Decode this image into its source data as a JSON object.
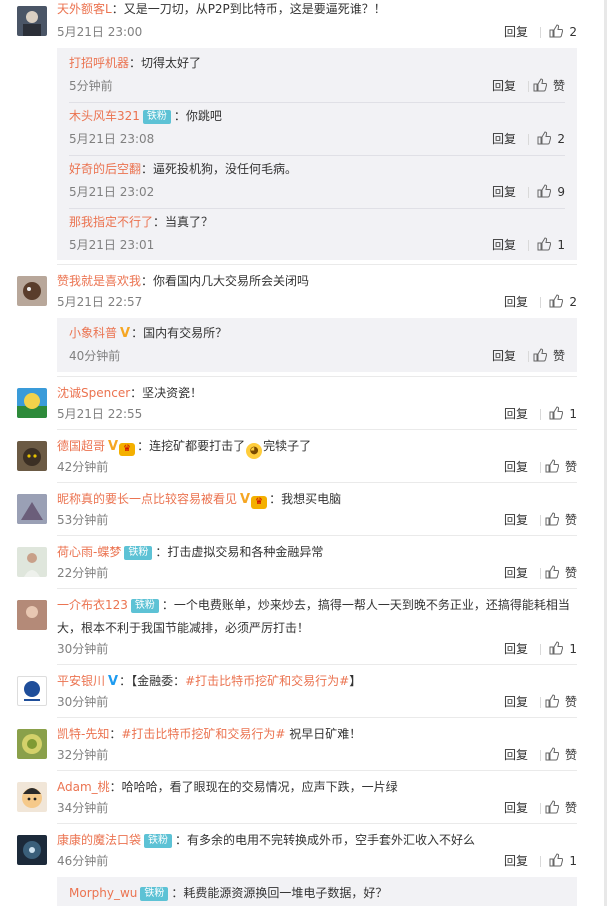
{
  "like_label": "赞",
  "reply_label": "回复",
  "badge_label": "铁粉",
  "comments": [
    {
      "name": "天外额客L",
      "text": "：又是一刀切，从P2P到比特币，这是要逼死谁？！",
      "time": "5月21日 23:00",
      "likes": "2",
      "replies": [
        {
          "name": "打招呼机器",
          "text": "：切得太好了",
          "time": "5分钟前",
          "likes": "赞"
        },
        {
          "name": "木头风车321",
          "badge": true,
          "text": "：你跳吧",
          "time": "5月21日 23:08",
          "likes": "2"
        },
        {
          "name": "好奇的后空翻",
          "text": "：逼死投机狗，没任何毛病。",
          "time": "5月21日 23:02",
          "likes": "9"
        },
        {
          "name": "那我指定不行了",
          "text": "：当真了？",
          "time": "5月21日 23:01",
          "likes": "1"
        }
      ]
    },
    {
      "name": "赞我就是喜欢我",
      "text": "：你看国内几大交易所会关闭吗",
      "time": "5月21日 22:57",
      "likes": "2",
      "replies": [
        {
          "name": "小象科普",
          "vip": true,
          "text": "：国内有交易所？",
          "time": "40分钟前",
          "likes": "赞"
        }
      ]
    },
    {
      "name": "沈诚Spencer",
      "text": "：坚决资瓷！",
      "time": "5月21日 22:55",
      "likes": "1"
    },
    {
      "name": "德国超哥",
      "vip": true,
      "medal": true,
      "text": "：连挖矿都要打击了",
      "text2": "完犊子了",
      "time": "42分钟前",
      "likes": "赞"
    },
    {
      "name": "昵称真的要长一点比较容易被看见",
      "vip": true,
      "medal": true,
      "text": "：我想买电脑",
      "time": "53分钟前",
      "likes": "赞"
    },
    {
      "name": "荷心雨-蝶梦",
      "badge": true,
      "text": "：打击虚拟交易和各种金融异常",
      "time": "22分钟前",
      "likes": "赞"
    },
    {
      "name": "一介布衣123",
      "badge": true,
      "text": "：一个电费账单，炒来炒去，搞得一帮人一天到晚不务正业，还搞得能耗相当大，根本不利于我国节能减排，必须严厉打击！",
      "time": "30分钟前",
      "likes": "1"
    },
    {
      "name": "平安银川",
      "bluev": true,
      "text": "：【金融委：",
      "topic": "#打击比特币挖矿和交易行为#",
      "text2": "】",
      "time": "30分钟前",
      "likes": "赞"
    },
    {
      "name": "凯特-先知",
      "text": "：",
      "topic": "#打击比特币挖矿和交易行为#",
      "text2": " 祝早日矿难！",
      "time": "32分钟前",
      "likes": "赞"
    },
    {
      "name": "Adam_桃",
      "text": "：哈哈哈，看了眼现在的交易情况，应声下跌，一片绿",
      "time": "34分钟前",
      "likes": "赞"
    },
    {
      "name": "康康的魔法口袋",
      "badge": true,
      "text": "：有多余的电用不完转换成外币，空手套外汇收入不好么",
      "time": "46分钟前",
      "likes": "1",
      "replies": [
        {
          "name": "Morphy_wu",
          "badge": true,
          "text": "：耗费能源资源换回一堆电子数据，好？"
        }
      ]
    }
  ]
}
